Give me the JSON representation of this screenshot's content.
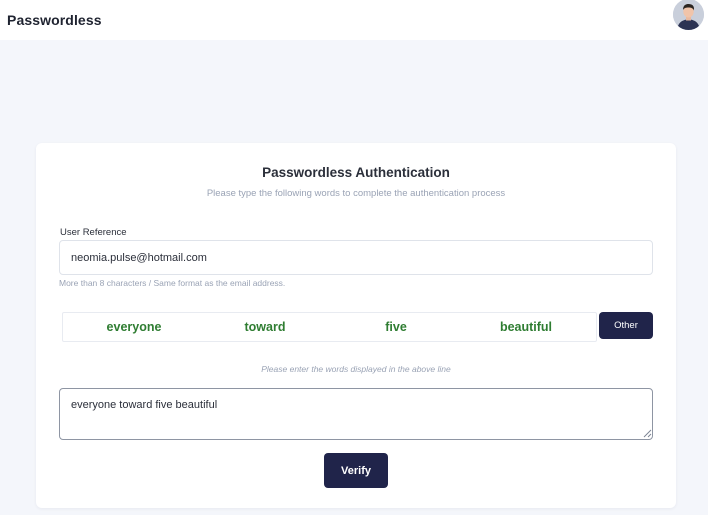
{
  "app": {
    "title": "Passwordless"
  },
  "card": {
    "title": "Passwordless Authentication",
    "subtitle": "Please type the following words to complete the authentication process",
    "user_reference": {
      "label": "User Reference",
      "value": "neomia.pulse@hotmail.com",
      "helper": "More than 8 characters / Same format as the email address."
    },
    "words": [
      "everyone",
      "toward",
      "five",
      "beautiful"
    ],
    "other_label": "Other",
    "hint": "Please enter the words displayed in the above line",
    "answer": "everyone toward five beautiful",
    "verify_label": "Verify"
  },
  "colors": {
    "primary": "#20244a",
    "word": "#2f7d32",
    "background": "#f4f6fb",
    "muted": "#9aa3b5"
  },
  "icons": {
    "avatar": "user-avatar-icon"
  }
}
